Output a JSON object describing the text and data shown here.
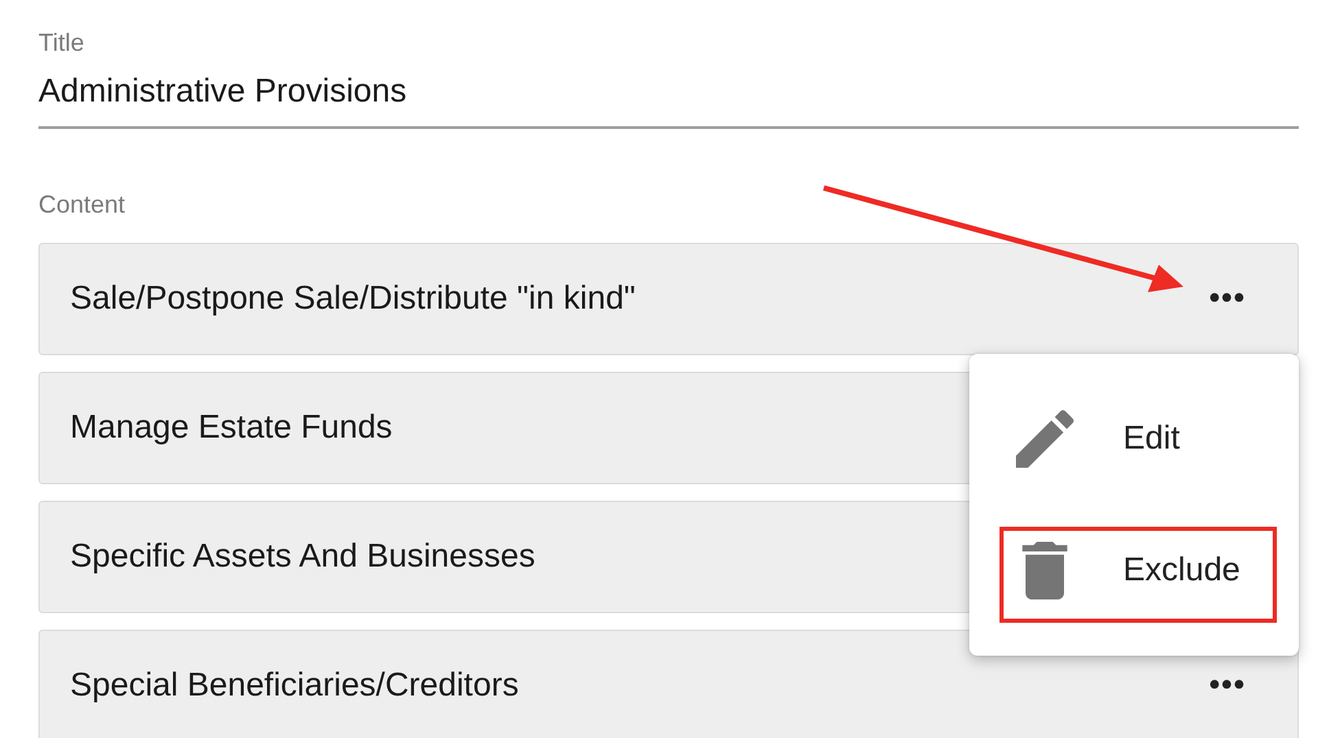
{
  "title_field": {
    "label": "Title",
    "value": "Administrative Provisions"
  },
  "content": {
    "label": "Content",
    "rows": [
      {
        "label": "Sale/Postpone Sale/Distribute \"in kind\"",
        "actions": "•••"
      },
      {
        "label": "Manage Estate Funds"
      },
      {
        "label": "Specific Assets And Businesses"
      },
      {
        "label": "Special Beneficiaries/Creditors",
        "actions": "•••"
      }
    ]
  },
  "annotations": [
    {
      "kind": "arrow"
    }
  ],
  "menu": {
    "items": [
      {
        "kind": "edit",
        "label": "Edit",
        "highlighted": false
      },
      {
        "kind": "delete",
        "label": "Exclude",
        "highlighted": true
      }
    ]
  }
}
